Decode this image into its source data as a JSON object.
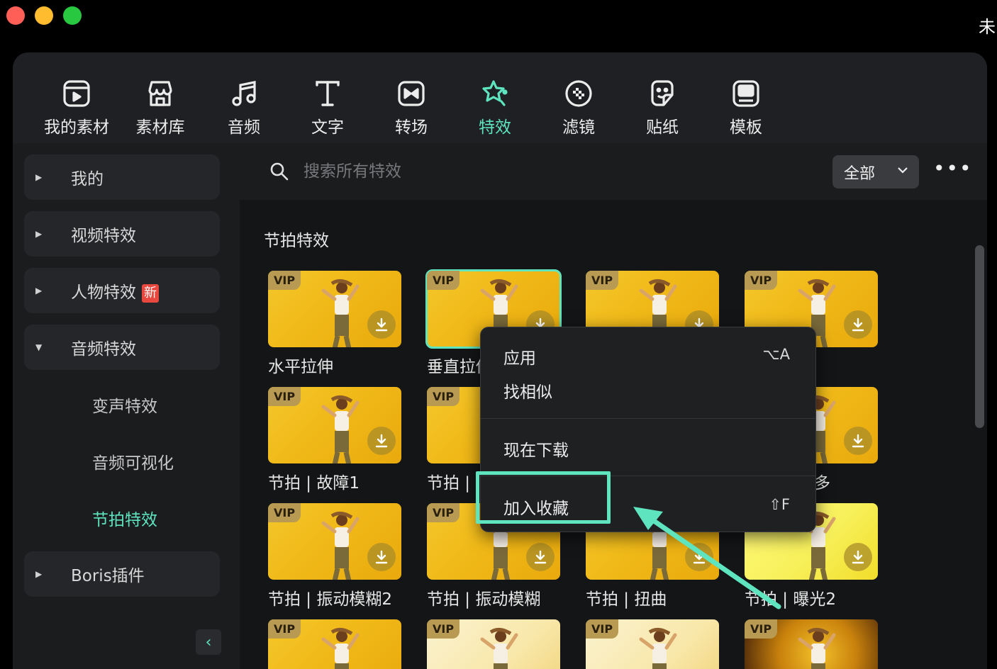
{
  "window": {
    "title_fragment": "未"
  },
  "toolbar": {
    "tabs": [
      {
        "label": "我的素材",
        "icon": "my-media-icon"
      },
      {
        "label": "素材库",
        "icon": "store-icon"
      },
      {
        "label": "音频",
        "icon": "music-note-icon"
      },
      {
        "label": "文字",
        "icon": "text-icon"
      },
      {
        "label": "转场",
        "icon": "transition-icon"
      },
      {
        "label": "特效",
        "icon": "effects-star-icon",
        "active": true
      },
      {
        "label": "滤镜",
        "icon": "filter-icon"
      },
      {
        "label": "贴纸",
        "icon": "sticker-icon"
      },
      {
        "label": "模板",
        "icon": "template-icon"
      }
    ]
  },
  "sidebar": {
    "categories": [
      {
        "label": "我的"
      },
      {
        "label": "视频特效"
      },
      {
        "label": "人物特效",
        "badge": "新"
      },
      {
        "label": "音频特效",
        "expanded": true
      },
      {
        "label": "Boris插件"
      }
    ],
    "sub_items": [
      {
        "label": "变声特效"
      },
      {
        "label": "音频可视化"
      },
      {
        "label": "节拍特效",
        "active": true
      }
    ]
  },
  "search": {
    "placeholder": "搜索所有特效",
    "filter_label": "全部",
    "more_label": "•••"
  },
  "section": {
    "title": "节拍特效"
  },
  "vip_label": "VIP",
  "cards": [
    {
      "caption": "水平拉伸"
    },
    {
      "caption": "垂直拉伸",
      "selected": true
    },
    {
      "caption": ""
    },
    {
      "caption": ""
    },
    {
      "caption": "节拍 | 故障1"
    },
    {
      "caption": "节拍 |"
    },
    {
      "caption": ""
    },
    {
      "caption": "多"
    },
    {
      "caption": "节拍 | 振动模糊2"
    },
    {
      "caption": "节拍 | 振动模糊"
    },
    {
      "caption": "节拍 | 扭曲"
    },
    {
      "caption": "节拍 | 曝光2"
    },
    {
      "caption": ""
    },
    {
      "caption": ""
    },
    {
      "caption": ""
    },
    {
      "caption": ""
    }
  ],
  "context_menu": {
    "apply": {
      "label": "应用",
      "shortcut": "⌥A"
    },
    "find_similar": {
      "label": "找相似"
    },
    "download_now": {
      "label": "现在下载"
    },
    "add_favorite": {
      "label": "加入收藏",
      "shortcut": "⇧F"
    }
  },
  "colors": {
    "accent": "#5ee5c0",
    "panel": "#1b1c1e",
    "vip_badge": "#b89a52",
    "new_badge": "#e8483e"
  }
}
